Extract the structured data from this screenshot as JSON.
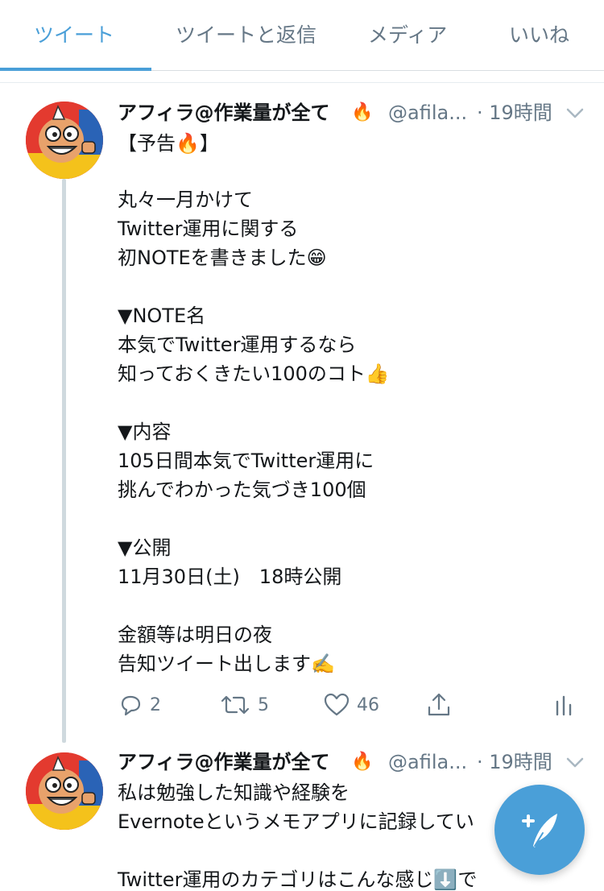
{
  "tabs": [
    {
      "label": "ツイート",
      "active": true
    },
    {
      "label": "ツイートと返信",
      "active": false
    },
    {
      "label": "メディア",
      "active": false
    },
    {
      "label": "いいね",
      "active": false
    }
  ],
  "accent_color": "#4a9fd8",
  "tweets": [
    {
      "name": "アフィラ@作業量が全て",
      "name_emoji": "🔥",
      "handle": "@afila...",
      "time": "· 19時間",
      "lines": [
        "【予告🔥】",
        "",
        "丸々一月かけて",
        "Twitter運用に関する",
        "初NOTEを書きました😁",
        "",
        "▼NOTE名",
        "本気でTwitter運用するなら",
        "知っておくきたい100のコト👍",
        "",
        "▼内容",
        "105日間本気でTwitter運用に",
        "挑んでわかった気づき100個",
        "",
        "▼公開",
        "11月30日(土)　18時公開",
        "",
        "金額等は明日の夜",
        "告知ツイート出します✍️"
      ],
      "reply_count": "2",
      "retweet_count": "5",
      "like_count": "46"
    },
    {
      "name": "アフィラ@作業量が全て",
      "name_emoji": "🔥",
      "handle": "@afila...",
      "time": "· 19時間",
      "lines": [
        "私は勉強した知識や経験を",
        "Evernoteというメモアプリに記録してい",
        "",
        "Twitter運用のカテゴリはこんな感じ⬇️で"
      ]
    }
  ],
  "icons": [
    "reply-icon",
    "retweet-icon",
    "like-icon",
    "share-icon",
    "analytics-icon",
    "chevron-down-icon",
    "compose-tweet-icon"
  ]
}
